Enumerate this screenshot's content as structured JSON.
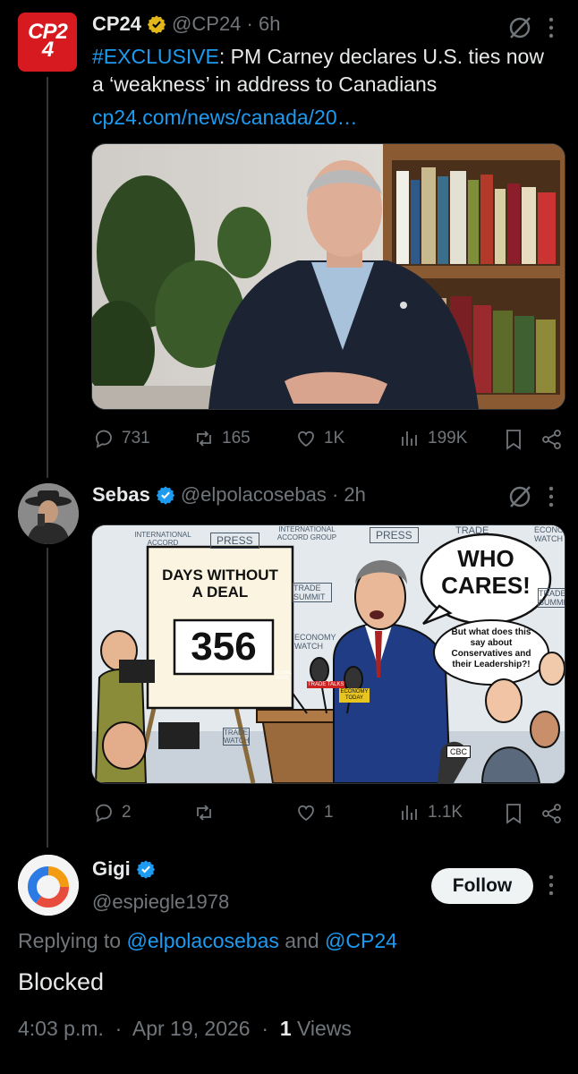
{
  "tweet1": {
    "avatar_text": "CP24",
    "name": "CP24",
    "handle": "@CP24",
    "time": "6h",
    "hashtag": "#EXCLUSIVE",
    "body_rest": ": PM Carney declares U.S. ties now a ‘weakness’ in address to Canadians",
    "link": "cp24.com/news/canada/20…",
    "stats": {
      "replies": "731",
      "reposts": "165",
      "likes": "1K",
      "views": "199K"
    }
  },
  "tweet2": {
    "name": "Sebas",
    "handle": "@elpolacosebas",
    "time": "2h",
    "cartoon": {
      "calendar_title": "DAYS WITHOUT A DEAL",
      "calendar_number": "356",
      "bubble_big": "WHO CARES!",
      "bubble_small": "But what does this say about Conservatives and their Leadership?!",
      "backdrop_labels": [
        "INTERNATIONAL ACCORD",
        "PRESS",
        "INTERNATIONAL ACCORD GROUP",
        "PRESS",
        "TRADE",
        "ECONOMY WATCH",
        "TRADE SUMMIT",
        "ECONOMY WATCH",
        "TRADE SUMMIT",
        "TRADE WATCH"
      ],
      "mic_labels": [
        "GLOBAL NEWS",
        "TRADE TALKS",
        "ECONOMY TODAY",
        "CBC"
      ]
    },
    "stats": {
      "replies": "2",
      "reposts": "",
      "likes": "1",
      "views": "1.1K"
    }
  },
  "tweet3": {
    "name": "Gigi",
    "handle": "@espiegle1978",
    "follow_label": "Follow",
    "replying_prefix": "Replying to",
    "replying_user1": "@elpolacosebas",
    "replying_and": "and",
    "replying_user2": "@CP24",
    "body": "Blocked",
    "time": "4:03 p.m.",
    "date": "Apr 19, 2026",
    "views_count": "1",
    "views_label": "Views"
  },
  "colors": {
    "accent": "#1d9bf0",
    "verified_blue": "#1d9bf0",
    "verified_gold": "#e2b719",
    "cp24_red": "#d71920"
  }
}
